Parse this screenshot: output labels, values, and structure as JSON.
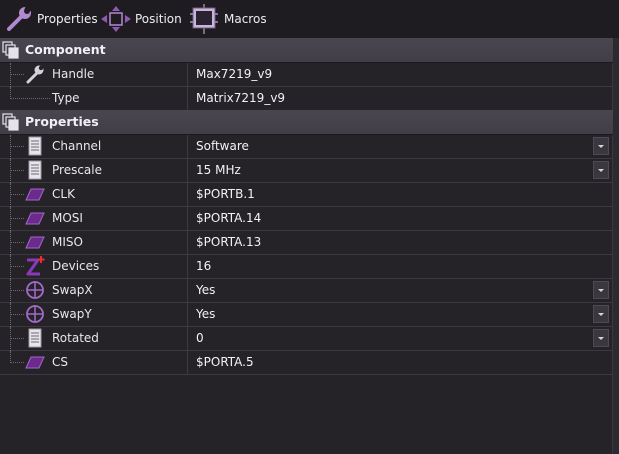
{
  "toolbar": {
    "properties_label": "Properties",
    "position_label": "Position",
    "macros_label": "Macros"
  },
  "component": {
    "header": "Component",
    "rows": [
      {
        "label": "Handle",
        "value": "Max7219_v9",
        "icon": "wrench-icon"
      },
      {
        "label": "Type",
        "value": "Matrix7219_v9",
        "icon": ""
      }
    ]
  },
  "properties": {
    "header": "Properties",
    "rows": [
      {
        "label": "Channel",
        "value": "Software",
        "icon": "list-icon",
        "dropdown": true
      },
      {
        "label": "Prescale",
        "value": "15 MHz",
        "icon": "list-icon",
        "dropdown": true
      },
      {
        "label": "CLK",
        "value": "$PORTB.1",
        "icon": "pin-icon",
        "dropdown": false
      },
      {
        "label": "MOSI",
        "value": "$PORTA.14",
        "icon": "pin-icon",
        "dropdown": false
      },
      {
        "label": "MISO",
        "value": "$PORTA.13",
        "icon": "pin-icon",
        "dropdown": false
      },
      {
        "label": "Devices",
        "value": "16",
        "icon": "integer-icon",
        "dropdown": false
      },
      {
        "label": "SwapX",
        "value": "Yes",
        "icon": "bool-icon",
        "dropdown": true
      },
      {
        "label": "SwapY",
        "value": "Yes",
        "icon": "bool-icon",
        "dropdown": true
      },
      {
        "label": "Rotated",
        "value": "0",
        "icon": "list-icon",
        "dropdown": true
      },
      {
        "label": "CS",
        "value": "$PORTA.5",
        "icon": "pin-icon",
        "dropdown": false
      }
    ]
  },
  "colors": {
    "background": "#252328",
    "section_header": "#46424c",
    "pin_icon": "#6b2a8c",
    "accent": "#a36bc9"
  }
}
